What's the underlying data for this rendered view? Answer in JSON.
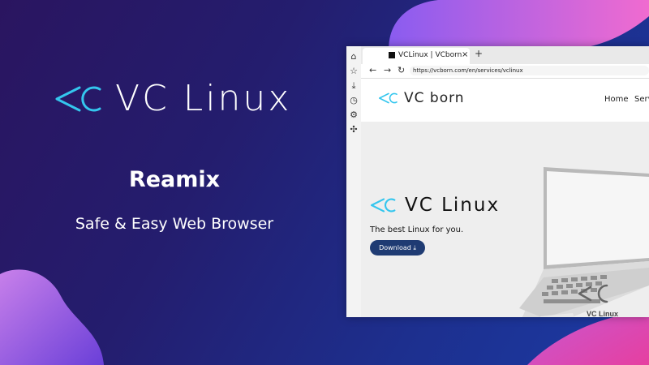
{
  "hero": {
    "brand": "VC Linux",
    "product": "Reamix",
    "tagline": "Safe & Easy Web Browser"
  },
  "browser": {
    "tab_title": "VCLinux | VCborn",
    "tab_close": "×",
    "new_tab": "+",
    "nav_back": "←",
    "nav_forward": "→",
    "nav_reload": "↻",
    "url": "https://vcborn.com/en/services/vclinux",
    "sidebar_icons": [
      "home-icon",
      "favorites-icon",
      "downloads-icon",
      "history-icon",
      "settings-icon",
      "extensions-icon"
    ]
  },
  "site": {
    "brand": "VC born",
    "menu": [
      "Home",
      "Serv"
    ],
    "product": "VC Linux",
    "tagline": "The best Linux for you.",
    "download_label": "Download",
    "laptop_screen_text": "VC Linux"
  },
  "colors": {
    "accent_cyan": "#34c6ee",
    "download_button": "#1f3b73",
    "bg_dark": "#241d6e"
  }
}
